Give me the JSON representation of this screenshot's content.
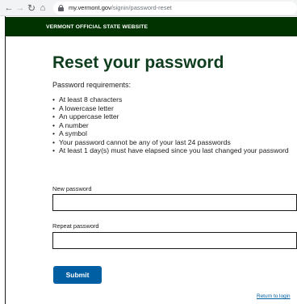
{
  "browser": {
    "back_icon": "arrow-left-icon",
    "forward_icon": "arrow-right-icon",
    "reload_icon": "reload-icon",
    "home_icon": "home-icon",
    "url_domain": "my.vermont.gov",
    "url_path": "/signin/password-reset"
  },
  "banner": {
    "text": "VERMONT OFFICIAL STATE WEBSITE",
    "color": "#003300"
  },
  "main": {
    "title": "Reset your password",
    "requirements_heading": "Password requirements:",
    "requirements": [
      "At least 8 characters",
      "A lowercase letter",
      "An uppercase letter",
      "A number",
      "A symbol",
      "Your password cannot be any of your last 24 passwords",
      "At least 1 day(s) must have elapsed since you last changed your password"
    ]
  },
  "form": {
    "new_password_label": "New password",
    "new_password_value": "",
    "repeat_password_label": "Repeat password",
    "repeat_password_value": "",
    "submit_label": "Submit",
    "submit_color": "#005ea2"
  },
  "footer": {
    "return_link": "Return to login"
  }
}
